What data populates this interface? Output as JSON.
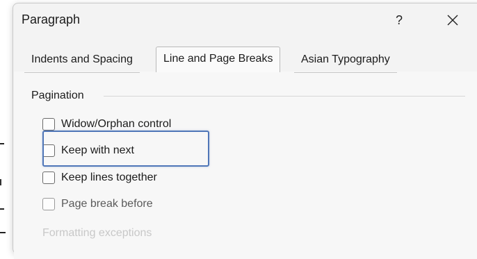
{
  "dialog": {
    "title": "Paragraph",
    "help_label": "?",
    "close_icon": "close-icon"
  },
  "tabs": [
    {
      "label": "Indents and Spacing",
      "selected": false
    },
    {
      "label": "Line and Page Breaks",
      "selected": true
    },
    {
      "label": "Asian Typography",
      "selected": false
    }
  ],
  "pagination": {
    "heading": "Pagination",
    "options": [
      {
        "label": "Widow/Orphan control",
        "checked": false
      },
      {
        "label": "Keep with next",
        "checked": false,
        "highlighted": true
      },
      {
        "label": "Keep lines together",
        "checked": false
      },
      {
        "label": "Page break before",
        "checked": false
      }
    ]
  },
  "next_section": {
    "heading": "Formatting exceptions"
  },
  "colors": {
    "dialog_bg": "#f3f3f3",
    "highlight_border": "#4f76b8"
  }
}
